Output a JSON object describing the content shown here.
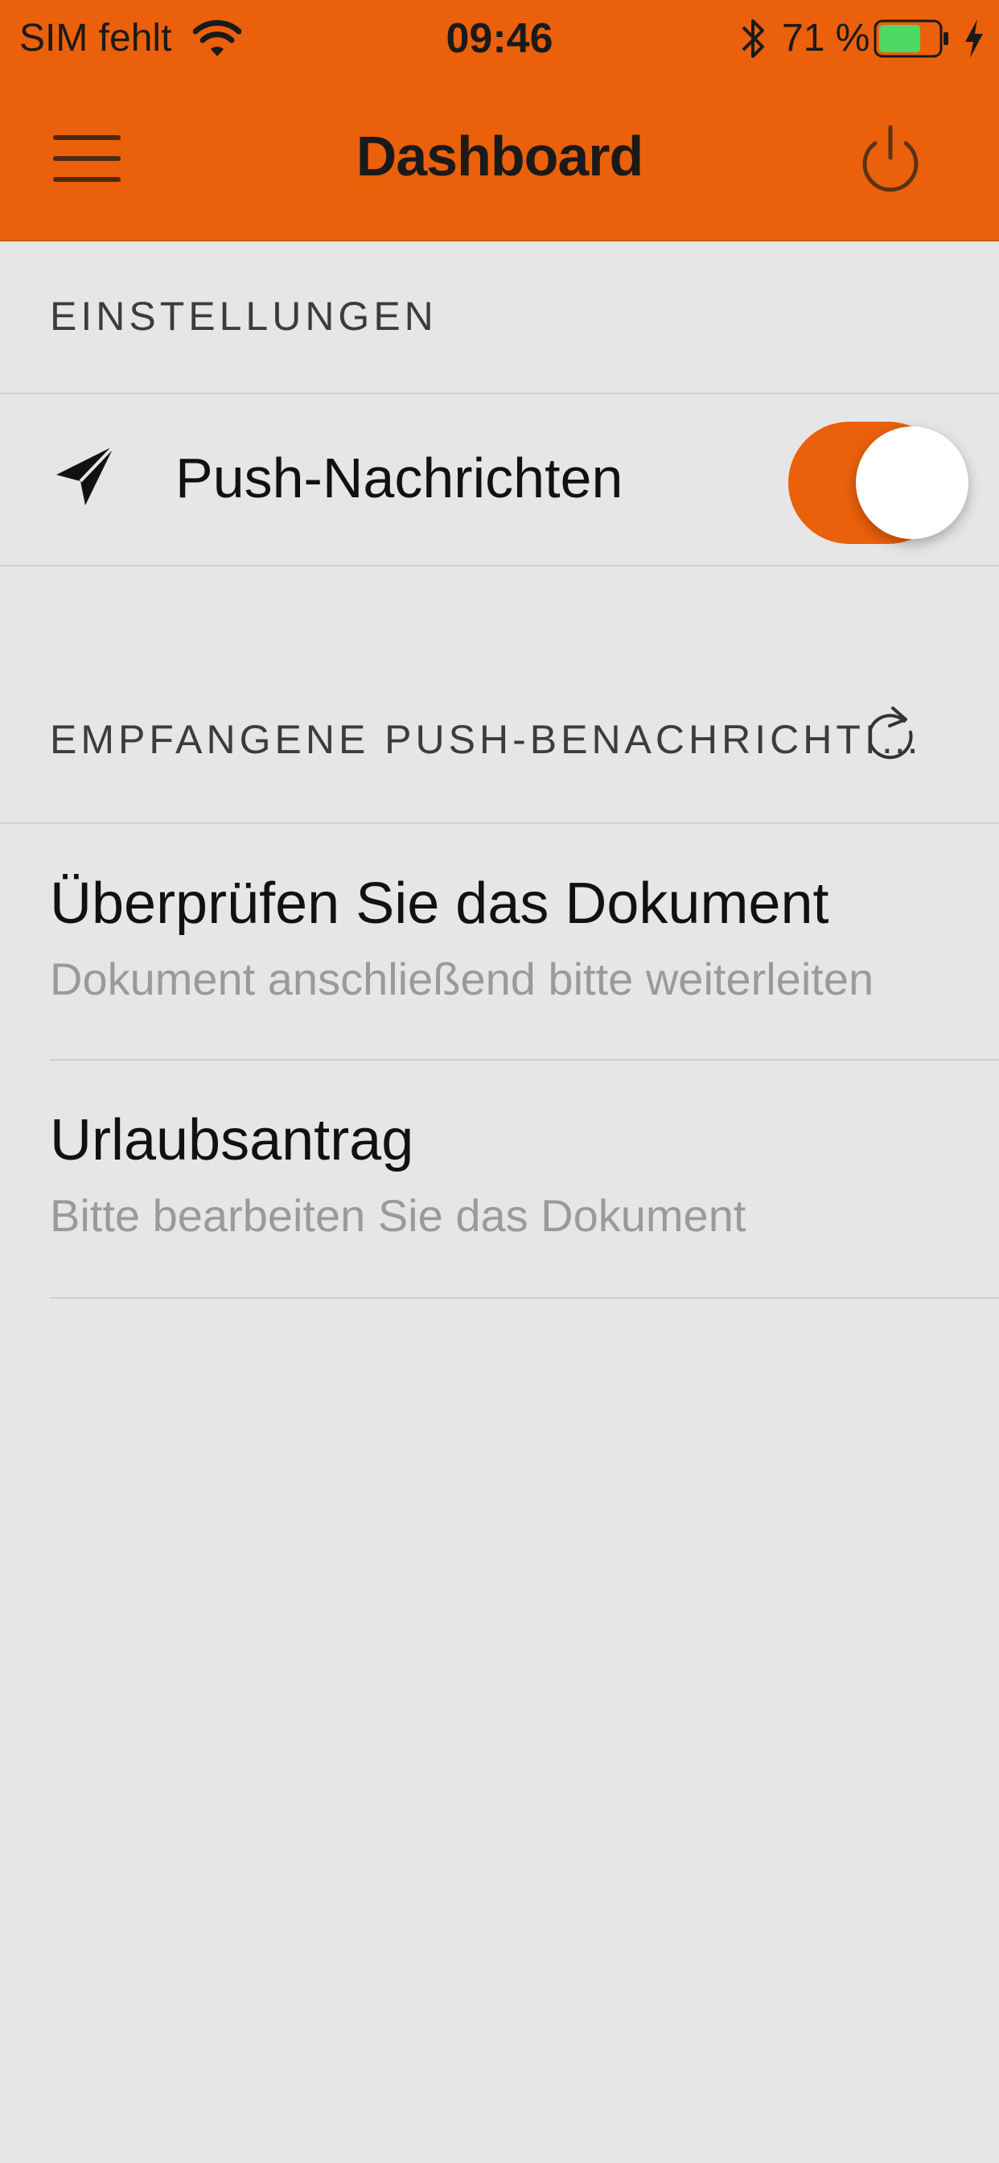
{
  "status_bar": {
    "carrier": "SIM fehlt",
    "time": "09:46",
    "battery_percent": "71 %",
    "battery_level": 0.71,
    "icons": [
      "wifi-icon",
      "bluetooth-icon",
      "battery-icon",
      "charging-icon"
    ]
  },
  "nav": {
    "title": "Dashboard",
    "left_icon": "menu-icon",
    "right_icon": "power-icon"
  },
  "settings": {
    "header": "EINSTELLUNGEN",
    "push_label": "Push-Nachrichten",
    "push_icon": "send-icon",
    "push_enabled": true
  },
  "notifications": {
    "header": "EMPFANGENE PUSH-BENACHRICHTI…",
    "refresh_icon": "refresh-icon",
    "items": [
      {
        "title": "Überprüfen Sie das Dokument",
        "subtitle": "Dokument anschließend bitte weiterleiten"
      },
      {
        "title": "Urlaubsantrag",
        "subtitle": "Bitte bearbeiten Sie das Dokument"
      }
    ]
  },
  "colors": {
    "accent": "#eb600b",
    "background": "#e6e6e6",
    "battery_fill": "#4cd964",
    "subtitle_text": "#9a9a9a"
  }
}
